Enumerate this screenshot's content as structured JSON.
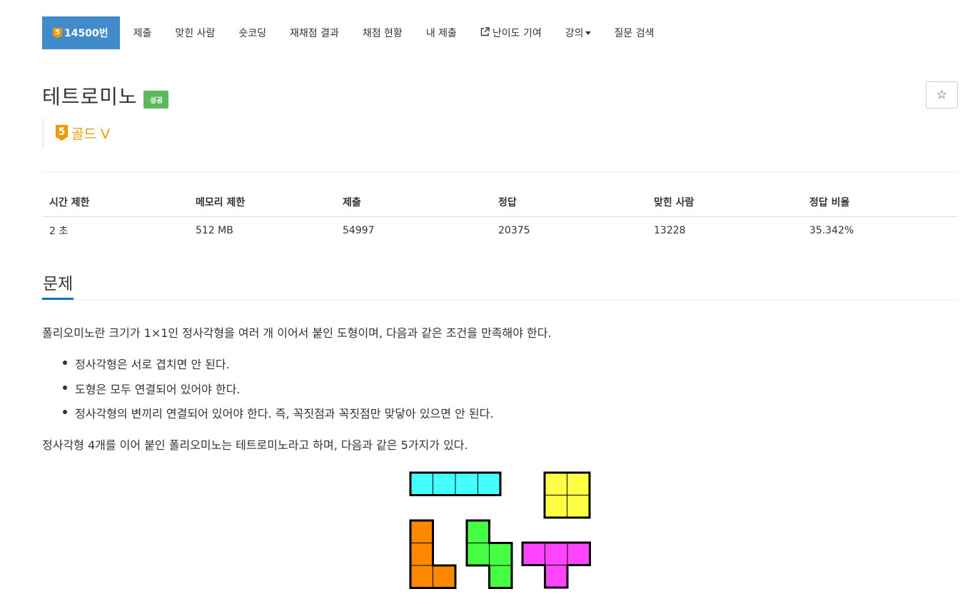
{
  "nav": {
    "active": {
      "badge": "5",
      "label": "14500번"
    },
    "items": [
      {
        "label": "제출"
      },
      {
        "label": "맞힌 사람"
      },
      {
        "label": "숏코딩"
      },
      {
        "label": "재채점 결과"
      },
      {
        "label": "채점 현황"
      },
      {
        "label": "내 제출"
      },
      {
        "label": "난이도 기여",
        "icon": "external-link-icon"
      },
      {
        "label": "강의",
        "icon": "caret-down-icon"
      },
      {
        "label": "질문 검색"
      }
    ]
  },
  "problem": {
    "title": "테트로미노",
    "status": "성공",
    "star": "☆",
    "tier_badge": "5",
    "tier_name": "골드 V"
  },
  "info_table": {
    "headers": [
      "시간 제한",
      "메모리 제한",
      "제출",
      "정답",
      "맞힌 사람",
      "정답 비율"
    ],
    "row": [
      "2 초",
      "512 MB",
      "54997",
      "20375",
      "13228",
      "35.342%"
    ]
  },
  "section": {
    "title": "문제",
    "intro": "폴리오미노란 크기가 1×1인 정사각형을 여러 개 이어서 붙인 도형이며, 다음과 같은 조건을 만족해야 한다.",
    "conditions": [
      "정사각형은 서로 겹치면 안 된다.",
      "도형은 모두 연결되어 있어야 한다.",
      "정사각형의 변끼리 연결되어 있어야 한다. 즉, 꼭짓점과 꼭짓점만 맞닿아 있으면 안 된다."
    ],
    "tetromino_intro": "정사각형 4개를 이어 붙인 폴리오미노는 테트로미노라고 하며, 다음과 같은 5가지가 있다."
  },
  "colors": {
    "accent": "#428bca",
    "tier_gold": "#ec9a00",
    "success": "#5cb85c",
    "tetromino_I": "#44ffff",
    "tetromino_O": "#ffff44",
    "tetromino_L": "#ff8800",
    "tetromino_S": "#44ff44",
    "tetromino_T": "#ff44ff"
  }
}
